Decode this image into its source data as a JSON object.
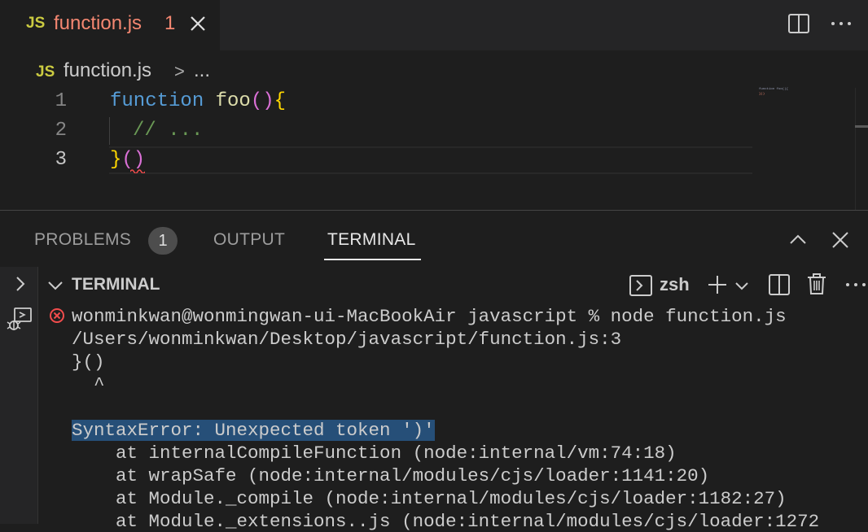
{
  "tab": {
    "badge": "JS",
    "filename": "function.js",
    "problem_count": "1"
  },
  "breadcrumb": {
    "badge": "JS",
    "file": "function.js",
    "chevron": ">",
    "ellipsis": "..."
  },
  "editor": {
    "line_numbers": [
      "1",
      "2",
      "3"
    ],
    "line1": {
      "keyword": "function",
      "name": "foo",
      "parens": "()",
      "brace": "{"
    },
    "line2": "// ...",
    "line3": {
      "brace": "}",
      "parens": "()"
    },
    "minimap": {
      "line1": "function foo(){",
      "line3": "}()"
    }
  },
  "panel": {
    "tabs": [
      {
        "label": "PROBLEMS",
        "badge": "1"
      },
      {
        "label": "OUTPUT"
      },
      {
        "label": "TERMINAL",
        "active": true
      }
    ]
  },
  "terminal": {
    "title": "TERMINAL",
    "shell": "zsh",
    "lines": [
      "wonminkwan@wonmingwan-ui-MacBookAir javascript % node function.js",
      "/Users/wonminkwan/Desktop/javascript/function.js:3",
      "}()",
      "  ^",
      "SyntaxError: Unexpected token ')'",
      "    at internalCompileFunction (node:internal/vm:74:18)",
      "    at wrapSafe (node:internal/modules/cjs/loader:1141:20)",
      "    at Module._compile (node:internal/modules/cjs/loader:1182:27)",
      "    at Module._extensions..js (node:internal/modules/cjs/loader:1272"
    ]
  },
  "colors": {
    "accent_error": "#f48771",
    "js_badge": "#cbcb41",
    "keyword": "#569cd6",
    "function_name": "#dcdcaa",
    "bracket": "#ffd700",
    "comment": "#6a9955",
    "selection": "#264f78"
  },
  "icons": [
    "close-icon",
    "split-editor-icon",
    "more-icon",
    "chevron-up-icon",
    "close-panel-icon",
    "terminal-icon",
    "plus-icon",
    "chevron-down-icon",
    "trash-icon",
    "error-icon",
    "debug-icon"
  ]
}
